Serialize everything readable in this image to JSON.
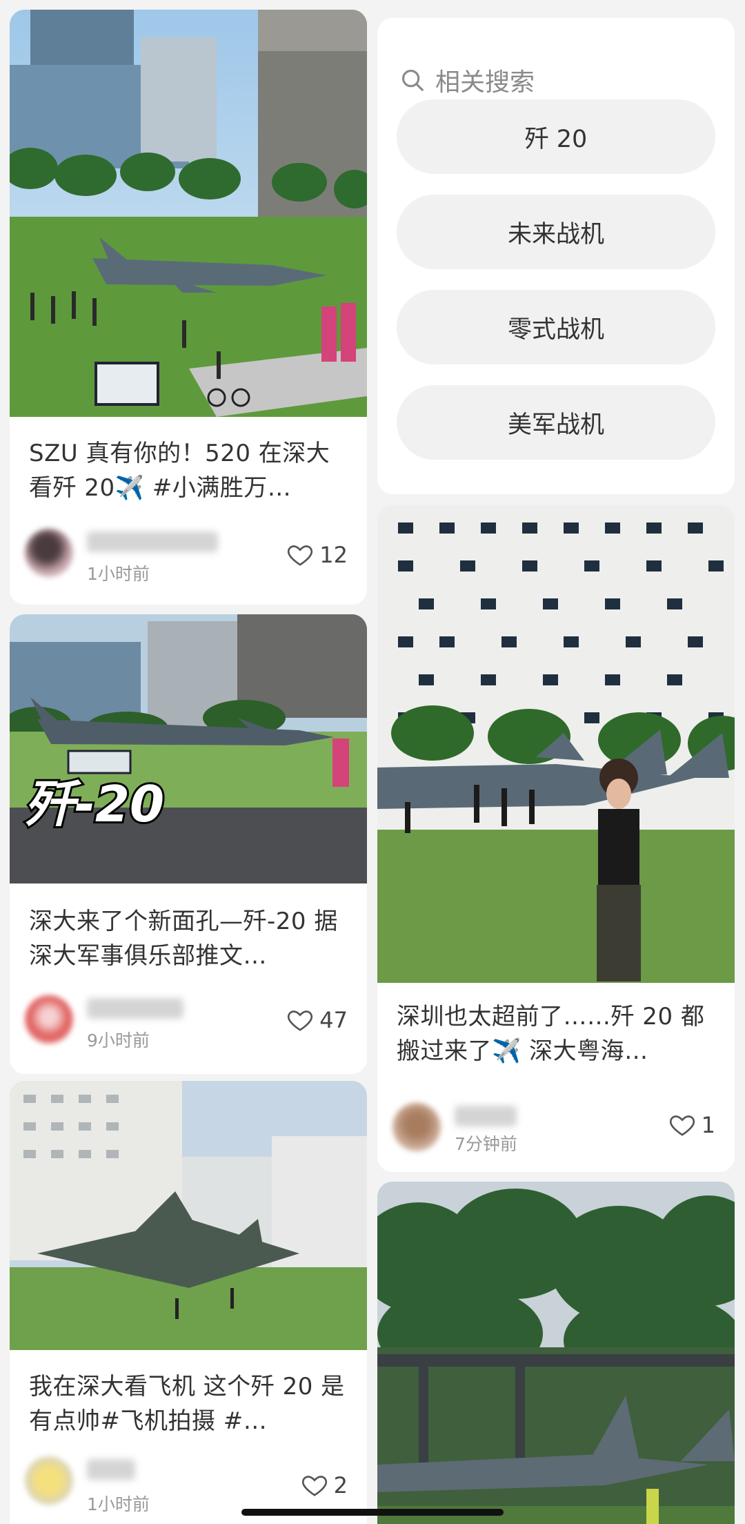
{
  "feed": {
    "left": [
      {
        "title": "SZU 真有你的！520 在深大看歼 20✈️ #小满胜万…",
        "time": "1小时前",
        "likes": "12",
        "image_desc": "fighter-jet-model-on-campus-lawn"
      },
      {
        "title": "深大来了个新面孔—歼-20 据深大军事俱乐部推文…",
        "time": "9小时前",
        "likes": "47",
        "overlay_text": "歼-20",
        "image_desc": "fighter-jet-near-buildings"
      },
      {
        "title": "我在深大看飞机 这个歼 20 是有点帅#飞机拍摄 #…",
        "time": "1小时前",
        "likes": "2",
        "image_desc": "fighter-jet-front-view"
      }
    ],
    "right": [
      {
        "title": "深圳也太超前了……歼 20 都搬过来了✈️ 深大粤海…",
        "time": "7分钟前",
        "likes": "1",
        "image_desc": "man-standing-before-jet"
      },
      {
        "image_desc": "jet-under-trees"
      }
    ]
  },
  "related": {
    "heading": "相关搜索",
    "items": [
      "歼 20",
      "未来战机",
      "零式战机",
      "美军战机"
    ]
  },
  "colors": {
    "background": "#f3f3f3",
    "card": "#ffffff",
    "pill": "#f1f1f1",
    "text": "#333333",
    "muted": "#9a9a9a"
  },
  "icons": {
    "search": "search-icon",
    "like": "heart-icon"
  }
}
